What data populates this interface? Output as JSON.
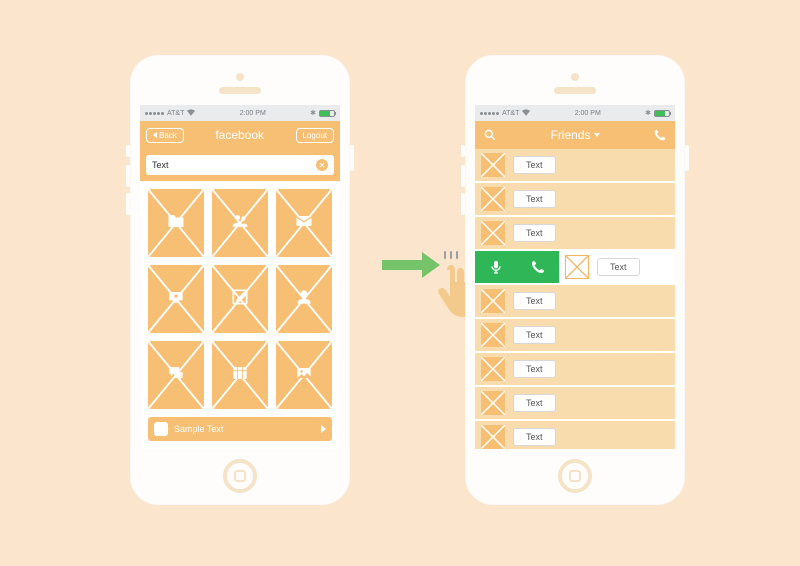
{
  "colors": {
    "accent": "#f6bf73",
    "swipe": "#2fb757",
    "bg": "#fbe6cd"
  },
  "status": {
    "carrier": "AT&T",
    "time": "2:00 PM"
  },
  "left": {
    "nav": {
      "back": "Back",
      "title": "facebook",
      "logout": "Logout"
    },
    "search": {
      "value": "Text"
    },
    "tiles": [
      {
        "icon": "folder"
      },
      {
        "icon": "group"
      },
      {
        "icon": "mail"
      },
      {
        "icon": "display"
      },
      {
        "icon": "compose"
      },
      {
        "icon": "person"
      },
      {
        "icon": "chat"
      },
      {
        "icon": "calendar"
      },
      {
        "icon": "photo"
      }
    ],
    "footer": {
      "label": "Sample Text"
    }
  },
  "right": {
    "nav": {
      "title": "Friends"
    },
    "rows": [
      {
        "label": "Text"
      },
      {
        "label": "Text"
      },
      {
        "label": "Text"
      },
      {
        "label": "Text",
        "swiped": true
      },
      {
        "label": "Text"
      },
      {
        "label": "Text"
      },
      {
        "label": "Text"
      },
      {
        "label": "Text"
      },
      {
        "label": "Text"
      }
    ]
  }
}
